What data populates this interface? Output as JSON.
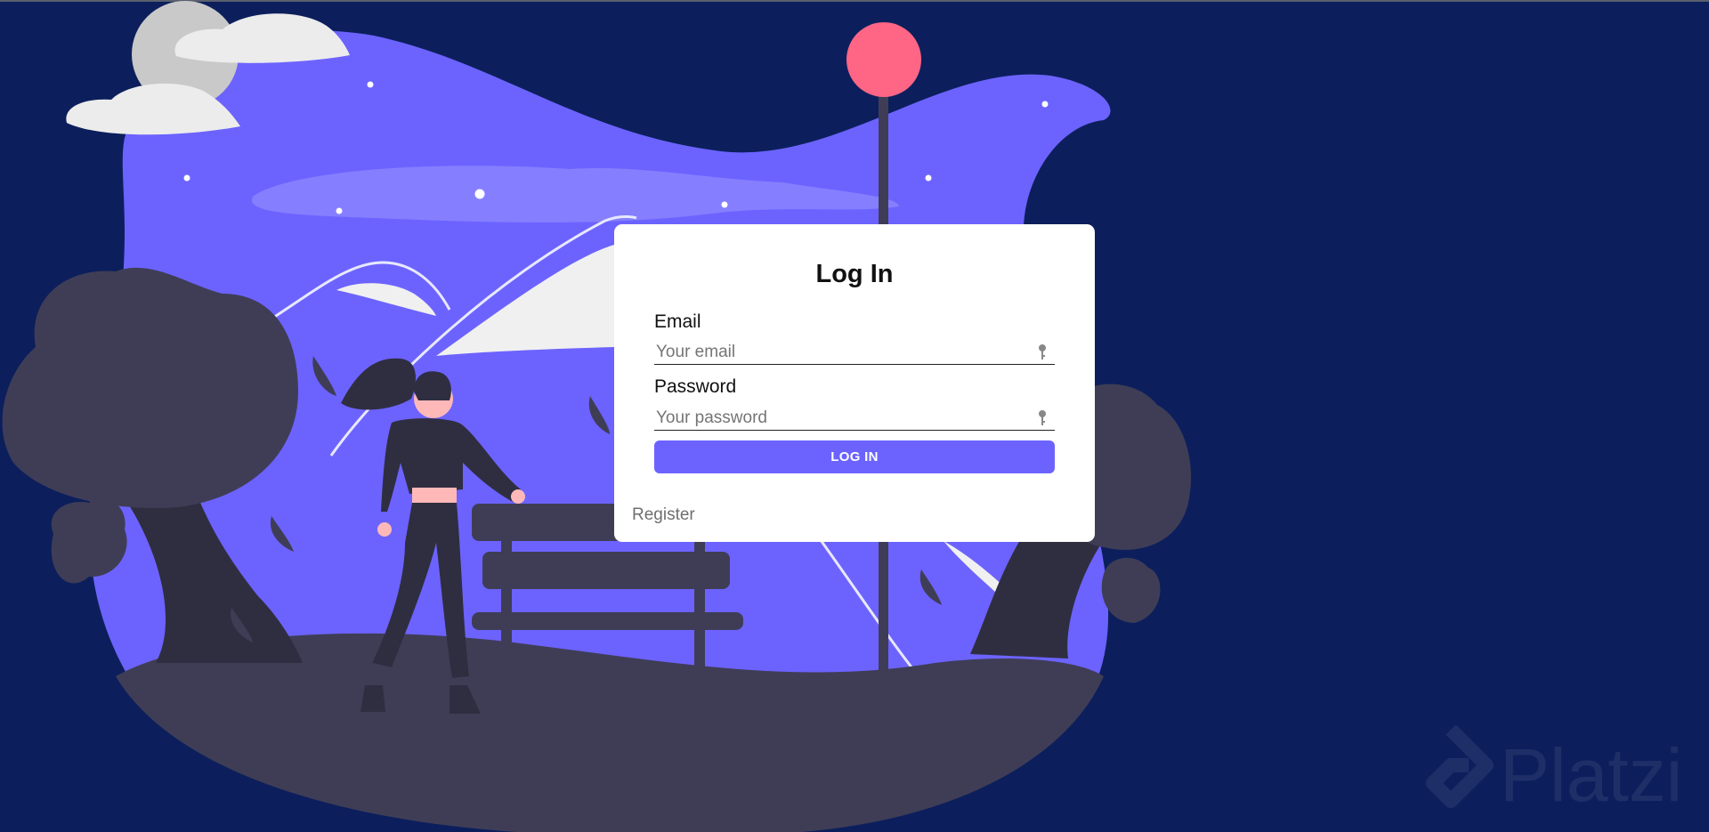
{
  "login": {
    "title": "Log In",
    "email_label": "Email",
    "email_placeholder": "Your email",
    "password_label": "Password",
    "password_placeholder": "Your password",
    "submit_label": "LOG IN",
    "register_label": "Register"
  },
  "colors": {
    "background": "#0c1f5c",
    "blob": "#6c63ff",
    "accent": "#6c63ff",
    "dark": "#3f3d56",
    "moon": "#ff6584"
  },
  "watermark": {
    "text": "Platzi"
  }
}
